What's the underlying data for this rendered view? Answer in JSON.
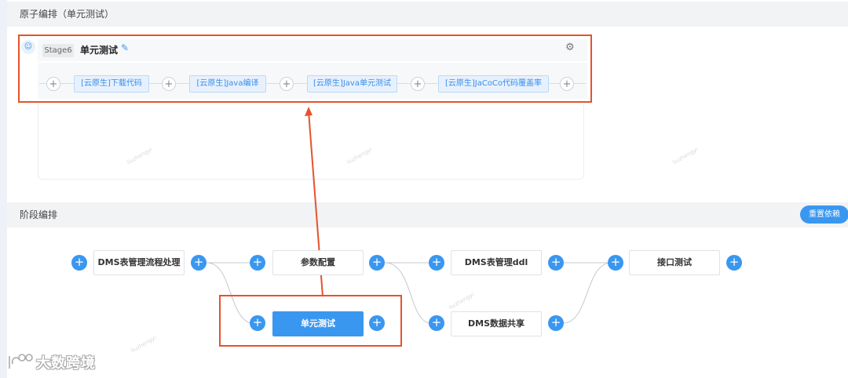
{
  "atom_section": {
    "title": "原子编排（单元测试）"
  },
  "stage": {
    "avatar_icon": "user-icon",
    "tag": "Stage6",
    "name": "单元测试",
    "edit_icon": "pencil-icon",
    "settings_icon": "gear-icon",
    "plus_symbol": "+",
    "atoms": [
      "[云原生]下载代码",
      "[云原生]Java编译",
      "[云原生]Java单元测试",
      "[云原生]JaCoCo代码覆盖率"
    ]
  },
  "stage_section": {
    "title": "阶段编排",
    "reset_button": "重置依赖",
    "plus_symbol": "+",
    "nodes": [
      "DMS表管理流程处理",
      "参数配置",
      "DMS表管理ddl",
      "接口测试",
      "单元测试",
      "DMS数据共享"
    ]
  },
  "watermark": "liuzhengyi",
  "logo": {
    "text": "大数跨境"
  },
  "colors": {
    "accent": "#3a97f0",
    "highlight": "#e5532b",
    "header_bg": "#f2f3f5"
  }
}
